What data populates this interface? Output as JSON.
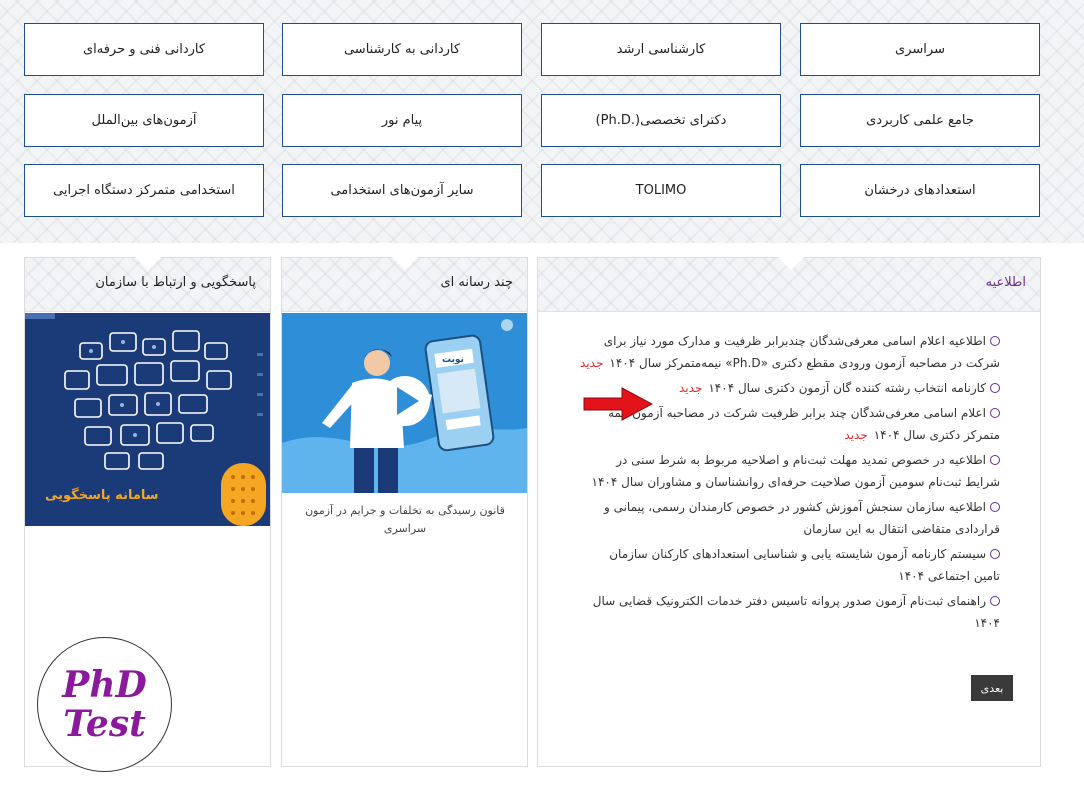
{
  "categories": [
    [
      "سراسری",
      "کارشناسی ارشد",
      "کاردانی به کارشناسی",
      "کاردانی فنی و حرفه‌ای"
    ],
    [
      "جامع علمی کاربردی",
      "دکترای تخصصی(.Ph.D)",
      "پیام نور",
      "آزمون‌های بین‌الملل"
    ],
    [
      "استعدادهای درخشان",
      "TOLIMO",
      "سایر آزمون‌های استخدامی",
      "استخدامی متمرکز دستگاه اجرایی"
    ]
  ],
  "panels": {
    "support": {
      "title": "پاسخگویی و ارتباط با سازمان",
      "banner_text": "سامانه پاسخگویی"
    },
    "media": {
      "title": "چند رسانه ای",
      "video_caption": "قانون رسیدگی به تخلفات و جرایم در آزمون سراسری",
      "phone_label": "نوبت"
    },
    "news": {
      "title": "اطلاعیه",
      "items": [
        {
          "text": "اطلاعیه اعلام اسامی معرفی‌شدگان چندبرابر ظرفیت و مدارک مورد نیاز برای شرکت در مصاحبه  آزمون ورودی مقطع دکتری «Ph.D» نیمه‌متمرکز سال ۱۴۰۴",
          "badge": "جدید"
        },
        {
          "text": "کارنامه انتخاب رشته کننده گان آزمون دکتری سال ۱۴۰۴",
          "badge": "جدید"
        },
        {
          "text": "اعلام اسامی معرفی‌شدگان چند برابر ظرفیت شرکت در مصاحبه آزمون نیمه متمرکز دکتری سال ۱۴۰۴",
          "badge": "جدید"
        },
        {
          "text": "اطلاعیه در خصوص  تمدید مهلت ثبت‌نام و اصلاحیه مربوط به شرط سنی  در شرایط ثبت‌نام سومین آزمون صلاحیت حرفه‌ای روانشناسان و مشاوران  سال ۱۴۰۴",
          "badge": ""
        },
        {
          "text": "اطلاعیه سازمان سنجش آموزش کشور در خصوص کارمندان رسمی، پیمانی و قراردادی متقاضی انتقال به این سازمان",
          "badge": ""
        },
        {
          "text": "سیستم کارنامه آزمون شایسته یابی و شناسایی استعدادهای کارکنان سازمان تامین اجتماعی ۱۴۰۴",
          "badge": ""
        },
        {
          "text": "راهنمای ثبت‌نام آزمون صدور پروانه تاسیس دفتر خدمات الکترونیک قضایی سال ۱۴۰۴",
          "badge": ""
        }
      ],
      "next_label": "بعدی"
    }
  },
  "watermark": {
    "line1": "PhD",
    "line2": "Test"
  },
  "colors": {
    "border_blue": "#1f4e8c",
    "bullet_purple": "#6a2c91",
    "new_red": "#e3262b",
    "title_purple": "#6a2c91",
    "banner_bg": "#1b3a78",
    "banner_orange": "#f5a623",
    "video_bg": "#2e8fd8"
  }
}
